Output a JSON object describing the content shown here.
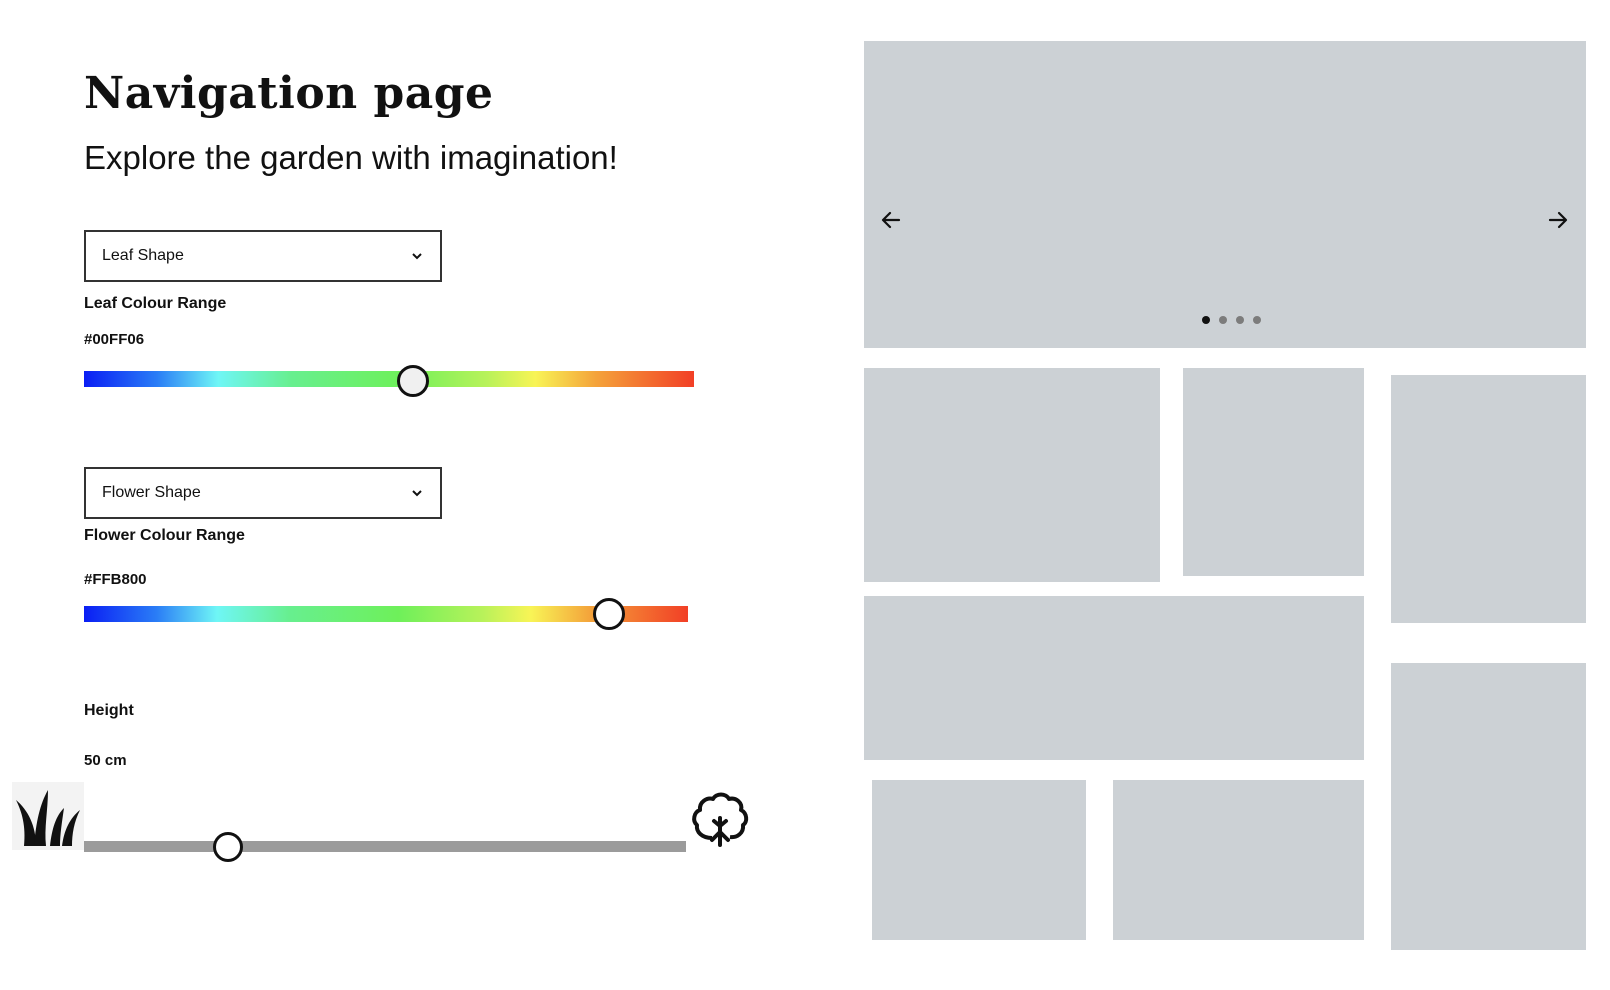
{
  "header": {
    "title": "Navigation page",
    "subtitle": "Explore the garden with imagination!"
  },
  "leaf": {
    "shape_select": "Leaf Shape",
    "colour_label": "Leaf Colour Range",
    "colour_value": "#00FF06",
    "slider_fraction": 0.54
  },
  "flower": {
    "shape_select": "Flower Shape",
    "colour_label": "Flower Colour Range",
    "colour_value": "#FFB800",
    "slider_fraction": 0.87
  },
  "height": {
    "label": "Height",
    "value": "50 cm",
    "slider_fraction": 0.24,
    "min_icon": "grass-icon",
    "max_icon": "tree-icon"
  },
  "carousel": {
    "prev_icon": "arrow-left-icon",
    "next_icon": "arrow-right-icon",
    "slide_count": 4,
    "active_slide": 1
  },
  "colors": {
    "placeholder": "#ccd1d5",
    "track": "#9b9b9b",
    "text": "#111111"
  }
}
